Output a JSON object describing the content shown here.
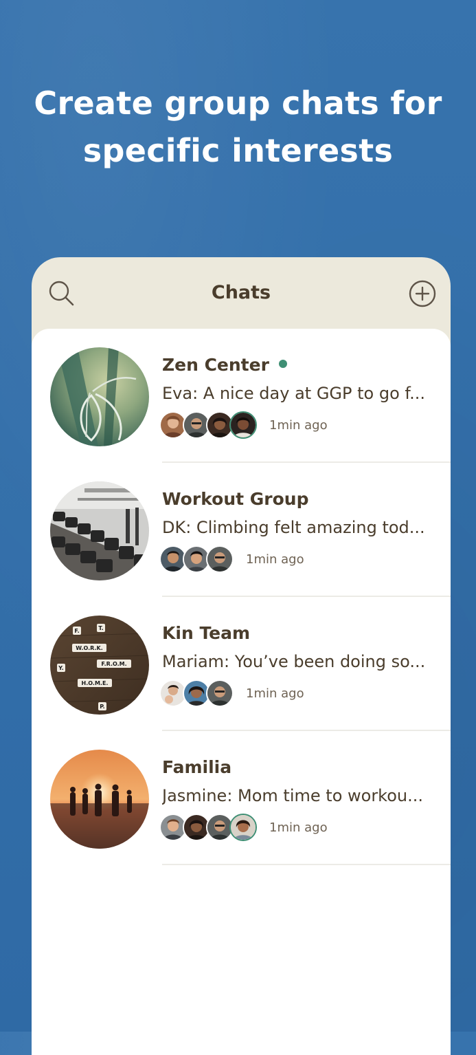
{
  "headline": {
    "line1": "Create group chats for",
    "line2": "specific interests"
  },
  "topbar": {
    "title": "Chats",
    "search_icon": "search-icon",
    "add_icon": "plus-circle-icon"
  },
  "chats": [
    {
      "name": "Zen Center",
      "online": true,
      "preview": "Eva: A nice day at GGP to go f...",
      "time": "1min ago",
      "photo": "plant-photo",
      "member_count_shown": 4
    },
    {
      "name": "Workout Group",
      "online": false,
      "preview": "DK: Climbing felt amazing tod...",
      "time": "1min ago",
      "photo": "gym-dumbbells-photo",
      "member_count_shown": 3
    },
    {
      "name": "Kin Team",
      "online": false,
      "preview": "Mariam: You’ve been doing so...",
      "time": "1min ago",
      "photo": "scrabble-tiles-photo",
      "tile_words": [
        "W.O.R.K.",
        "F.R.O.M.",
        "H.O.M.E.",
        "F.",
        "T.",
        "Y.",
        "P."
      ],
      "member_count_shown": 3
    },
    {
      "name": "Familia",
      "online": false,
      "preview": "Jasmine: Mom time to workou...",
      "time": "1min ago",
      "photo": "sunset-family-photo",
      "member_count_shown": 4
    }
  ],
  "colors": {
    "background": "#3371ab",
    "header_bar": "#ece9dc",
    "text_primary": "#4a3d2c",
    "online": "#3f8f74"
  }
}
